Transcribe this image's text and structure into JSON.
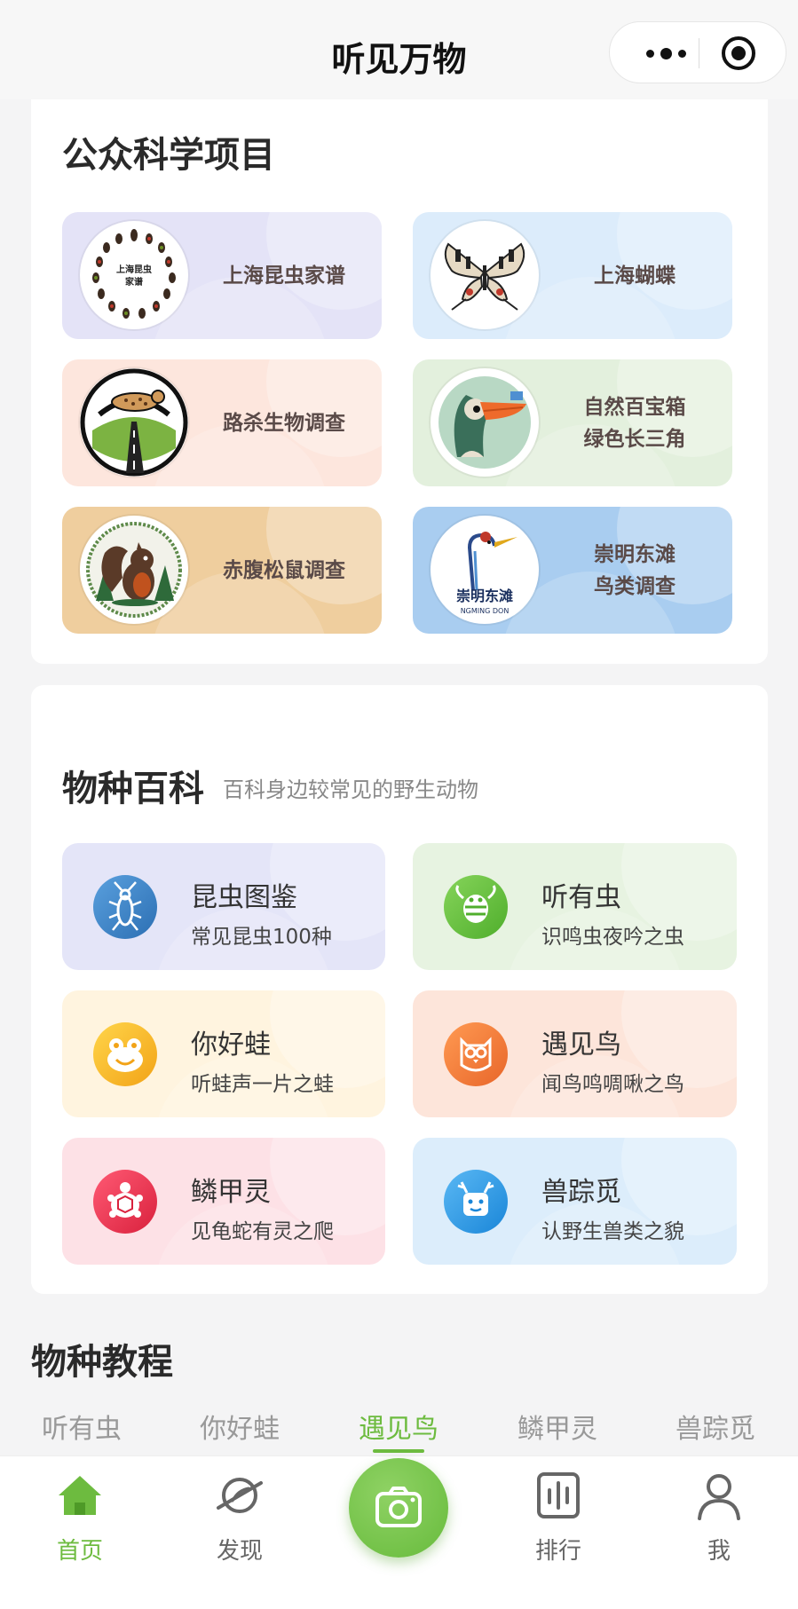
{
  "navbar": {
    "title": "听见万物",
    "more_icon": "more-dots-icon",
    "close_icon": "target-circle-icon"
  },
  "citizen_science": {
    "title": "公众科学项目",
    "projects": [
      {
        "label": "上海昆虫家谱",
        "logo_text": "上海昆虫\n家谱",
        "bg": "#e4e3f7",
        "icon": "insect-collection-logo"
      },
      {
        "label": "上海蝴蝶",
        "bg": "#dcecfb",
        "icon": "butterfly-logo"
      },
      {
        "label": "路杀生物调查",
        "bg": "#fde6dd",
        "icon": "roadkill-leopard-cat-logo"
      },
      {
        "label": "自然百宝箱\n绿色长三角",
        "bg": "#e3f0dd",
        "icon": "toucan-logo"
      },
      {
        "label": "赤腹松鼠调查",
        "bg": "#efce9e",
        "icon": "squirrel-logo"
      },
      {
        "label": "崇明东滩\n鸟类调查",
        "logo_text": "崇明东滩",
        "logo_sub": "NGMING DON",
        "bg": "#a9cdf0",
        "icon": "crane-logo"
      }
    ]
  },
  "encyclopedia": {
    "title": "物种百科",
    "subtitle": "百科身边较常见的野生动物",
    "items": [
      {
        "name": "昆虫图鉴",
        "desc": "常见昆虫100种",
        "bg": "#e4e5f8",
        "icon": "cricket-icon",
        "color": "#3f84c6"
      },
      {
        "name": "听有虫",
        "desc": "识鸣虫夜吟之虫",
        "bg": "#e7f3e1",
        "icon": "bee-icon",
        "color": "#63be3c"
      },
      {
        "name": "你好蛙",
        "desc": "听蛙声一片之蛙",
        "bg": "#fff4df",
        "icon": "frog-icon",
        "color": "#f6bb27"
      },
      {
        "name": "遇见鸟",
        "desc": "闻鸟鸣啁啾之鸟",
        "bg": "#fde5da",
        "icon": "owl-icon",
        "color": "#f07a34"
      },
      {
        "name": "鳞甲灵",
        "desc": "见龟蛇有灵之爬",
        "bg": "#fde1e6",
        "icon": "turtle-icon",
        "color": "#e8344f"
      },
      {
        "name": "兽踪觅",
        "desc": "认野生兽类之貌",
        "bg": "#dcedfb",
        "icon": "deer-icon",
        "color": "#2d9be8"
      }
    ]
  },
  "tutorial": {
    "title": "物种教程",
    "tabs": [
      "听有虫",
      "你好蛙",
      "遇见鸟",
      "鳞甲灵",
      "兽踪觅"
    ],
    "active_tab": "遇见鸟"
  },
  "tabbar": {
    "items": [
      {
        "label": "首页",
        "icon": "home-icon",
        "active": true
      },
      {
        "label": "发现",
        "icon": "planet-icon",
        "active": false
      },
      {
        "label": "",
        "icon": "camera-icon",
        "active": false
      },
      {
        "label": "排行",
        "icon": "ranking-bars-icon",
        "active": false
      },
      {
        "label": "我",
        "icon": "person-icon",
        "active": false
      }
    ],
    "accent": "#6dbb3f"
  }
}
